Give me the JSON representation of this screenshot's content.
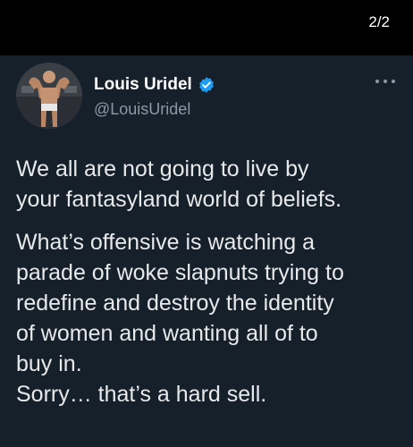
{
  "header": {
    "page_indicator": "2/2"
  },
  "tweet": {
    "author": {
      "name": "Louis Uridel",
      "handle": "@LouisUridel",
      "verified": true
    },
    "paragraph1": [
      "We all are not going to live by",
      "your fantasyland world of beliefs."
    ],
    "paragraph2": [
      "What’s offensive is watching a",
      "parade of woke slapnuts trying to",
      "redefine and destroy the identity",
      "of women and wanting all of to",
      "buy in.",
      "Sorry… that’s a hard sell."
    ]
  },
  "colors": {
    "background": "#15202b",
    "top_bar": "#000000",
    "text": "#e7e9ea",
    "secondary_text": "#8b98a5",
    "verified_badge": "#1d9bf0"
  },
  "icons": {
    "verified": "verified-badge-icon",
    "more": "more-options-icon"
  }
}
